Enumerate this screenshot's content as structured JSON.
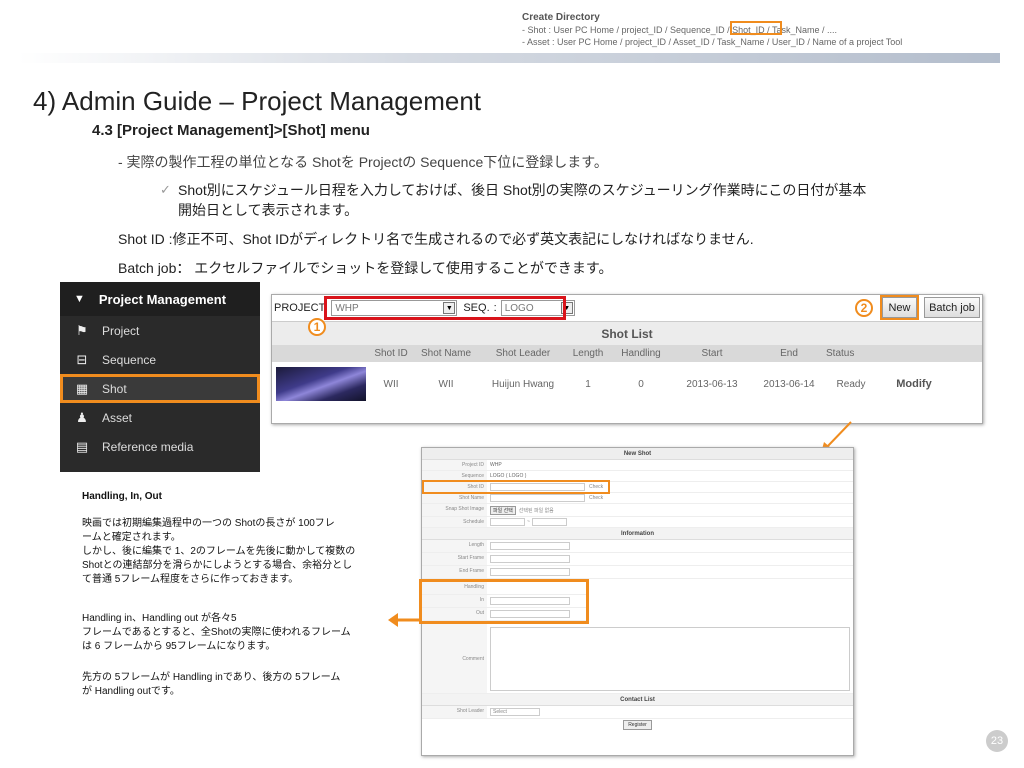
{
  "directory": {
    "title": "Create Directory",
    "line1": "- Shot : User PC Home / project_ID / Sequence_ID / Shot_ID / Task_Name / ....",
    "line2": "- Asset : User PC Home / project_ID / Asset_ID / Task_Name / User_ID / Name of a project Tool"
  },
  "heading": "4) Admin Guide – Project Management",
  "subheading": "4.3 [Project Management]>[Shot] menu",
  "para1": "- 実際の製作工程の単位となる Shotを Projectの Sequence下位に登録します。",
  "bullet_mark": "✓",
  "para2a": "Shot別にスケジュール日程を入力しておけば、後日 Shot別の実際のスケジューリング作業時にこの日付が基本",
  "para2b": "開始日として表示されます。",
  "para3": "Shot ID :修正不可、Shot IDがディレクトリ名で生成されるので必ず英文表記にしなければなりません.",
  "para4": "Batch job： エクセルファイルでショットを登録して使用することができます。",
  "sidebar": {
    "header": "Project Management",
    "items": [
      {
        "label": "Project",
        "icon": "flag-icon",
        "glyph": "⚑"
      },
      {
        "label": "Sequence",
        "icon": "sequence-icon",
        "glyph": "⊟"
      },
      {
        "label": "Shot",
        "icon": "film-icon",
        "glyph": "▦"
      },
      {
        "label": "Asset",
        "icon": "asset-icon",
        "glyph": "♟"
      },
      {
        "label": "Reference media",
        "icon": "document-icon",
        "glyph": "▤"
      }
    ]
  },
  "shotlist": {
    "project_label": "PROJECT",
    "project_value": "WHP",
    "seq_label": "SEQ.",
    "seq_value": "LOGO",
    "new_btn": "New",
    "batch_btn": "Batch job",
    "title": "Shot List",
    "columns": [
      "Shot ID",
      "Shot Name",
      "Shot Leader",
      "Length",
      "Handling",
      "Start",
      "End",
      "Status"
    ],
    "row": {
      "shot_id": "WII",
      "shot_name": "WII",
      "leader": "Huijun Hwang",
      "length": "1",
      "handling": "0",
      "start": "2013-06-13",
      "end": "2013-06-14",
      "status": "Ready",
      "action": "Modify"
    },
    "marker1": "1",
    "marker2": "2"
  },
  "notes": {
    "title": "Handling, In, Out",
    "p1": [
      "映画では初期編集過程中の一つの Shotの長さが 100フレ",
      "ームと確定されます。",
      "しかし、後に編集で 1、2のフレームを先後に動かして複数の",
      "Shotとの連結部分を滑らかにしようとする場合、余裕分とし",
      "て普通 5フレーム程度をさらに作っておきます。"
    ],
    "p2": [
      "Handling in、Handling out が各々5",
      "フレームであるとすると、全Shotの実際に使われるフレーム",
      "は 6 フレームから 95フレームになります。"
    ],
    "p3": [
      "先方の 5フレームが Handling inであり、後方の 5フレーム",
      "が Handling outです。"
    ]
  },
  "form": {
    "title": "New Shot",
    "project_label": "Project ID",
    "project_value": "WHP",
    "sequence_label": "Sequence",
    "sequence_value": "LOGO ( LOGO )",
    "shotid_label": "Shot ID",
    "shotname_label": "Shot Name",
    "check": "Check",
    "snap_label": "Snap Shot Image",
    "file_btn": "파일 선택",
    "file_text": "선택된 파일 없음",
    "schedule_label": "Schedule",
    "schedule_sep": "~",
    "info_title": "Information",
    "length_label": "Length",
    "start_label": "Start Frame",
    "end_label": "End Frame",
    "handling_label": "Handling",
    "in_label": "In",
    "out_label": "Out",
    "comment_label": "Comment",
    "contact_title": "Contact List",
    "leader_label": "Shot Leader",
    "leader_value": "Select",
    "register": "Register"
  },
  "page_number": "23",
  "colors": {
    "accent": "#f08c1e",
    "red": "#d9141b"
  }
}
